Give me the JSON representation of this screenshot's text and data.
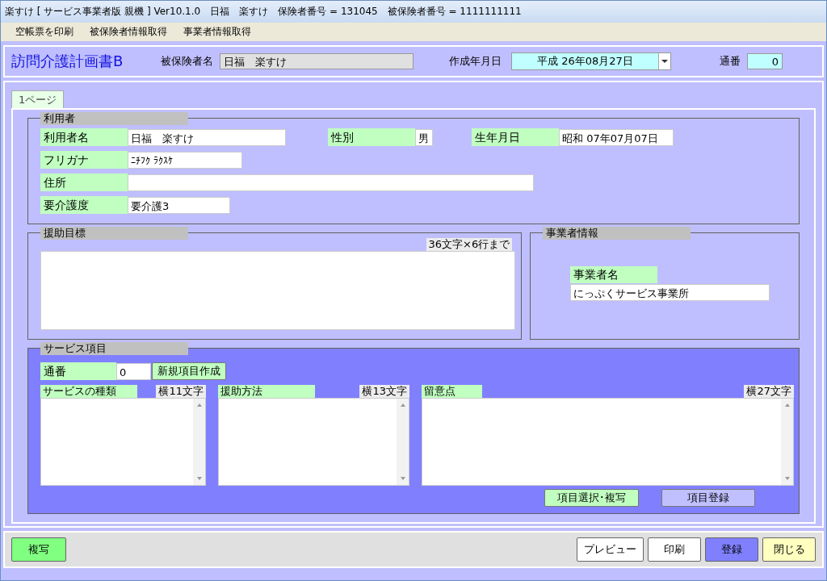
{
  "window": {
    "title": "楽すけ [ サービス事業者版 親機 ] Ver10.1.0　日福　楽すけ　保険者番号 = 131045　被保険者番号 = 1111111111"
  },
  "menu": [
    "空帳票を印刷",
    "被保険者情報取得",
    "事業者情報取得"
  ],
  "header": {
    "title": "訪問介護計画書B",
    "insured_label": "被保険者名",
    "insured_name": "日福　楽すけ",
    "date_label": "作成年月日",
    "date": "平成 26年08月27日",
    "number_label": "通番",
    "number": "0"
  },
  "tabs": [
    {
      "label": "1ページ",
      "selected": true
    }
  ],
  "user": {
    "title": "利用者",
    "fields": [
      {
        "label": "利用者名",
        "value": "日福　楽すけ"
      },
      {
        "label": "性別",
        "value": "男"
      },
      {
        "label": "生年月日",
        "value": "昭和 07年07月07日"
      },
      {
        "label": "フリガナ",
        "value": "ﾆﾁﾌｸ ﾗｸｽｹ"
      },
      {
        "label": "住所"
      },
      {
        "label": "要介護度",
        "value": "要介護3"
      }
    ]
  },
  "goal": {
    "title": "援助目標",
    "limit": "36文字×6行まで"
  },
  "provider": {
    "title": "事業者情報",
    "label": "事業者名",
    "value": "にっぷくサービス事業所"
  },
  "service": {
    "title": "サービス項目",
    "number_label": "通番",
    "number": "0",
    "new_button": "新規項目作成",
    "columns": [
      {
        "label": "サービスの種類",
        "limit": "横11文字"
      },
      {
        "label": "援助方法",
        "limit": "横13文字"
      },
      {
        "label": "留意点",
        "limit": "横27文字"
      }
    ],
    "buttons": [
      "項目選択･複写",
      "項目登録"
    ]
  },
  "footer": {
    "left": [
      {
        "label": "複写",
        "color": "#80ff80"
      }
    ],
    "right": [
      {
        "label": "プレビュー",
        "color": "#ffffff"
      },
      {
        "label": "印刷",
        "color": "#ffffff"
      },
      {
        "label": "登録",
        "color": "#8080ff"
      },
      {
        "label": "閉じる",
        "color": "#ffffc0"
      }
    ]
  }
}
